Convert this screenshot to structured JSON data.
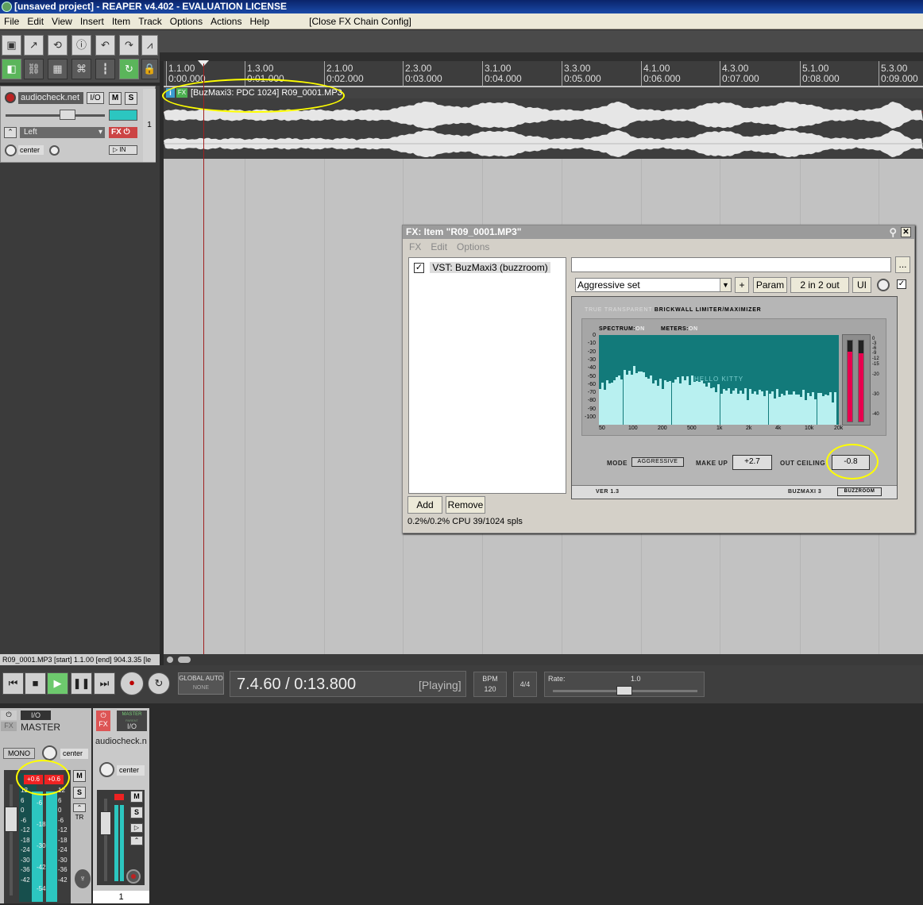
{
  "window": {
    "title": "[unsaved project] - REAPER v4.402 - EVALUATION LICENSE"
  },
  "menu": {
    "items": [
      "File",
      "Edit",
      "View",
      "Insert",
      "Item",
      "Track",
      "Options",
      "Actions",
      "Help"
    ],
    "extra": "[Close FX Chain Config]"
  },
  "ruler": {
    "marks": [
      {
        "bar": "1.1.00",
        "time": "0:00.000"
      },
      {
        "bar": "1.3.00",
        "time": "0:01.000"
      },
      {
        "bar": "2.1.00",
        "time": "0:02.000"
      },
      {
        "bar": "2.3.00",
        "time": "0:03.000"
      },
      {
        "bar": "3.1.00",
        "time": "0:04.000"
      },
      {
        "bar": "3.3.00",
        "time": "0:05.000"
      },
      {
        "bar": "4.1.00",
        "time": "0:06.000"
      },
      {
        "bar": "4.3.00",
        "time": "0:07.000"
      },
      {
        "bar": "5.1.00",
        "time": "0:08.000"
      },
      {
        "bar": "5.3.00",
        "time": "0:09.000"
      }
    ]
  },
  "track": {
    "name": "audiocheck.net",
    "io": "I/O",
    "mute": "M",
    "solo": "S",
    "input": "Left",
    "fx": "FX",
    "pan": "center",
    "in": "IN",
    "number": "1"
  },
  "item": {
    "label": "[BuzMaxi3: PDC 1024] R09_0001.MP3",
    "badge_i": "i",
    "badge_fx": "FX"
  },
  "status": {
    "text": "R09_0001.MP3 [start] 1.1.00 [end] 904.3.35 [le"
  },
  "transport": {
    "global_auto": "GLOBAL AUTO",
    "none": "NONE",
    "position": "7.4.60 / 0:13.800",
    "state": "[Playing]",
    "bpm_label": "BPM",
    "bpm": "120",
    "timesig": "4/4",
    "rate_label": "Rate:",
    "rate": "1.0"
  },
  "master": {
    "io": "I/O",
    "fx": "FX",
    "name": "MASTER",
    "mono": "MONO",
    "pan": "center",
    "peak_l": "+0.6",
    "peak_r": "+0.6",
    "mute": "M",
    "solo": "S",
    "tr": "TR",
    "scale_left": [
      "12",
      "6",
      "0",
      "-6",
      "-12",
      "-18",
      "-24",
      "-30",
      "-36",
      "-42"
    ],
    "scale_mid": [
      "-6",
      "-18",
      "-30",
      "-42",
      "-54"
    ],
    "scale_right": [
      "12",
      "6",
      "0",
      "-6",
      "-12",
      "-18",
      "-24",
      "-30",
      "-36",
      "-42"
    ]
  },
  "mixtrack": {
    "fx": "FX",
    "master_send": "MASTER",
    "send_sub": "PARENT",
    "io": "I/O",
    "name": "audiocheck.n",
    "pan": "center",
    "mute": "M",
    "solo": "S",
    "number": "1"
  },
  "fx": {
    "title": "FX: Item \"R09_0001.MP3\"",
    "menu": [
      "FX",
      "Edit",
      "Options"
    ],
    "plugin_entry": "VST: BuzMaxi3 (buzzroom)",
    "preset_name": "",
    "browse": "...",
    "preset": "Aggressive set",
    "plus": "+",
    "param": "Param",
    "io": "2 in 2 out",
    "ui": "UI",
    "add": "Add",
    "remove": "Remove",
    "cpu": "0.2%/0.2% CPU 39/1024 spls"
  },
  "plugin": {
    "header_dim": "TRUE TRANSPARENT",
    "header": "BRICKWALL LIMITER/MAXIMIZER",
    "spectrum_label": "SPECTRUM:",
    "spectrum_state": "ON",
    "meters_label": "METERS:",
    "meters_state": "ON",
    "watermark": "HELLO KITTY",
    "y_labels": [
      "0",
      "-10",
      "-20",
      "-30",
      "-40",
      "-50",
      "-60",
      "-70",
      "-80",
      "-90",
      "-100"
    ],
    "x_labels": [
      "50",
      "100",
      "200",
      "500",
      "1k",
      "2k",
      "4k",
      "10k",
      "20k"
    ],
    "meter_scale": [
      "0",
      "-3",
      "-6",
      "-9",
      "-12",
      "-15",
      "-20",
      "-30",
      "-40"
    ],
    "meter_levels": [
      0.86,
      0.84
    ],
    "mode_label": "MODE",
    "mode": "AGGRESSIVE",
    "makeup_label": "MAKE UP",
    "makeup": "+2.7",
    "ceiling_label": "OUT CEILING",
    "ceiling": "-0.8",
    "version": "VER 1.3",
    "product": "BUZMAXI 3",
    "brand": "BUZZROOM"
  },
  "colors": {
    "accent_highlight": "#ffff00",
    "spectrum_bg": "#127a7a",
    "meter_red": "#e8004e",
    "mixer_meter": "#2cc6c0"
  }
}
